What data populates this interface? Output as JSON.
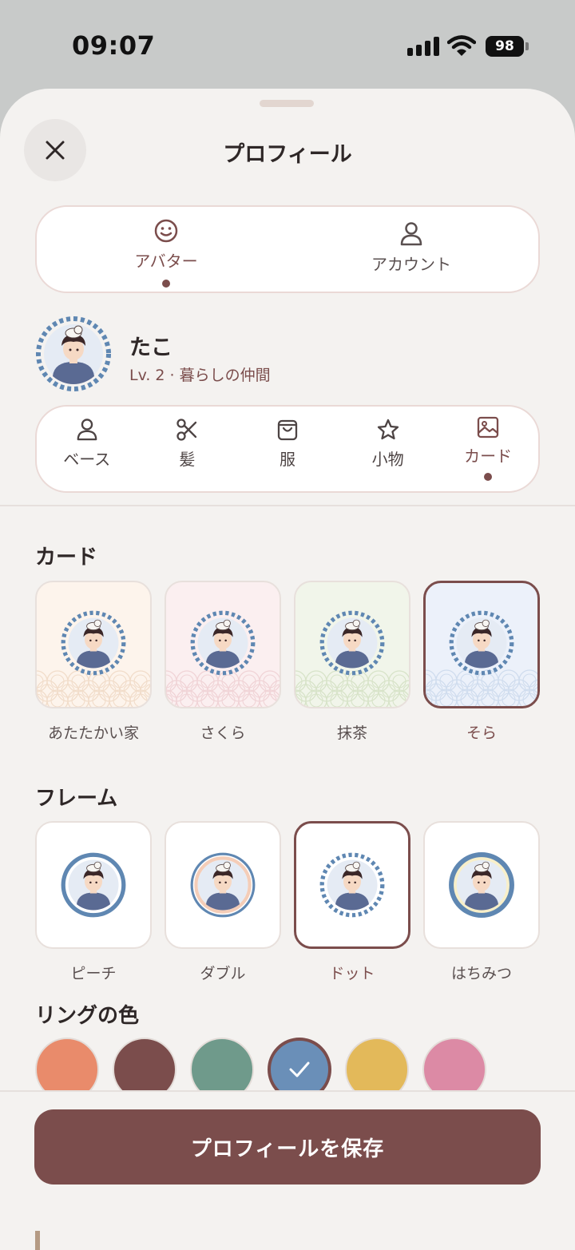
{
  "status": {
    "time": "09:07",
    "battery": "98"
  },
  "header": {
    "title": "プロフィール"
  },
  "segments": [
    {
      "label": "アバター",
      "icon": "smile-icon",
      "active": true
    },
    {
      "label": "アカウント",
      "icon": "person-icon",
      "active": false
    }
  ],
  "profile": {
    "name": "たこ",
    "level": "Lv. 2 · 暮らしの仲間"
  },
  "categories": [
    {
      "label": "ベース",
      "icon": "person-icon"
    },
    {
      "label": "髪",
      "icon": "scissors-icon"
    },
    {
      "label": "服",
      "icon": "bag-icon"
    },
    {
      "label": "小物",
      "icon": "star-icon"
    },
    {
      "label": "カード",
      "icon": "image-icon",
      "active": true
    }
  ],
  "cards": {
    "title": "カード",
    "items": [
      {
        "label": "あたたかい家",
        "bg": "#fdf4ec",
        "wave": "#f1dcc9"
      },
      {
        "label": "さくら",
        "bg": "#fbeff0",
        "wave": "#f0d3d6"
      },
      {
        "label": "抹茶",
        "bg": "#f1f5ea",
        "wave": "#d7e3c8"
      },
      {
        "label": "そら",
        "bg": "#ecf1fa",
        "wave": "#cfdcee",
        "selected": true
      }
    ]
  },
  "frames": {
    "title": "フレーム",
    "items": [
      {
        "label": "ピーチ"
      },
      {
        "label": "ダブル"
      },
      {
        "label": "ドット",
        "selected": true
      },
      {
        "label": "はちみつ"
      }
    ]
  },
  "ring_colors": {
    "title": "リングの色",
    "colors": [
      "#e98b6b",
      "#7b4d4c",
      "#6f9a8b",
      "#6a8fb8",
      "#e3b95a",
      "#dc8aa5"
    ],
    "selected_index": 3
  },
  "save_label": "プロフィールを保存",
  "accent": "#7b4d4c"
}
